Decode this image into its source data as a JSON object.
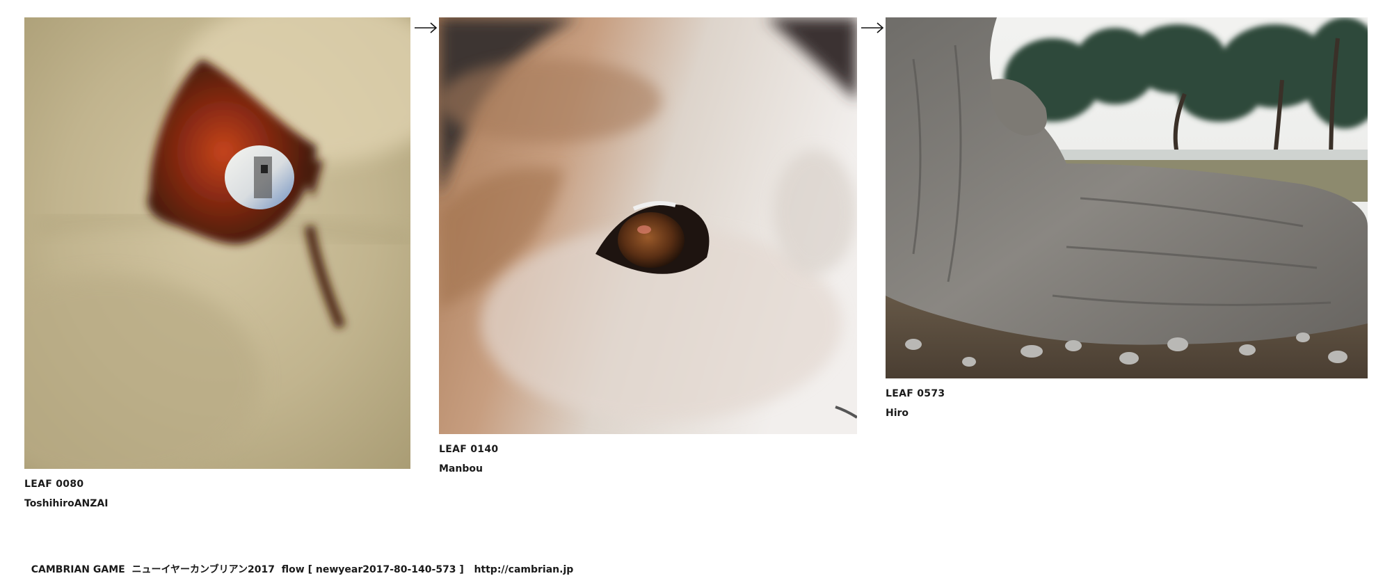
{
  "leaves": [
    {
      "id": "LEAF 0080",
      "author": "ToshihiroANZAI",
      "image": "peephole-eye-photo"
    },
    {
      "id": "LEAF 0140",
      "author": "Manbou",
      "image": "dog-eye-closeup-photo"
    },
    {
      "id": "LEAF 0573",
      "author": "Hiro",
      "image": "tree-trunk-root-park-photo"
    }
  ],
  "arrows": [
    "right-arrow-icon",
    "right-arrow-icon"
  ],
  "footer": {
    "game": "CAMBRIAN GAME",
    "event": "ニューイヤーカンブリアン2017",
    "flow": "flow [ newyear2017-80-140-573 ]",
    "url": "http://cambrian.jp"
  }
}
